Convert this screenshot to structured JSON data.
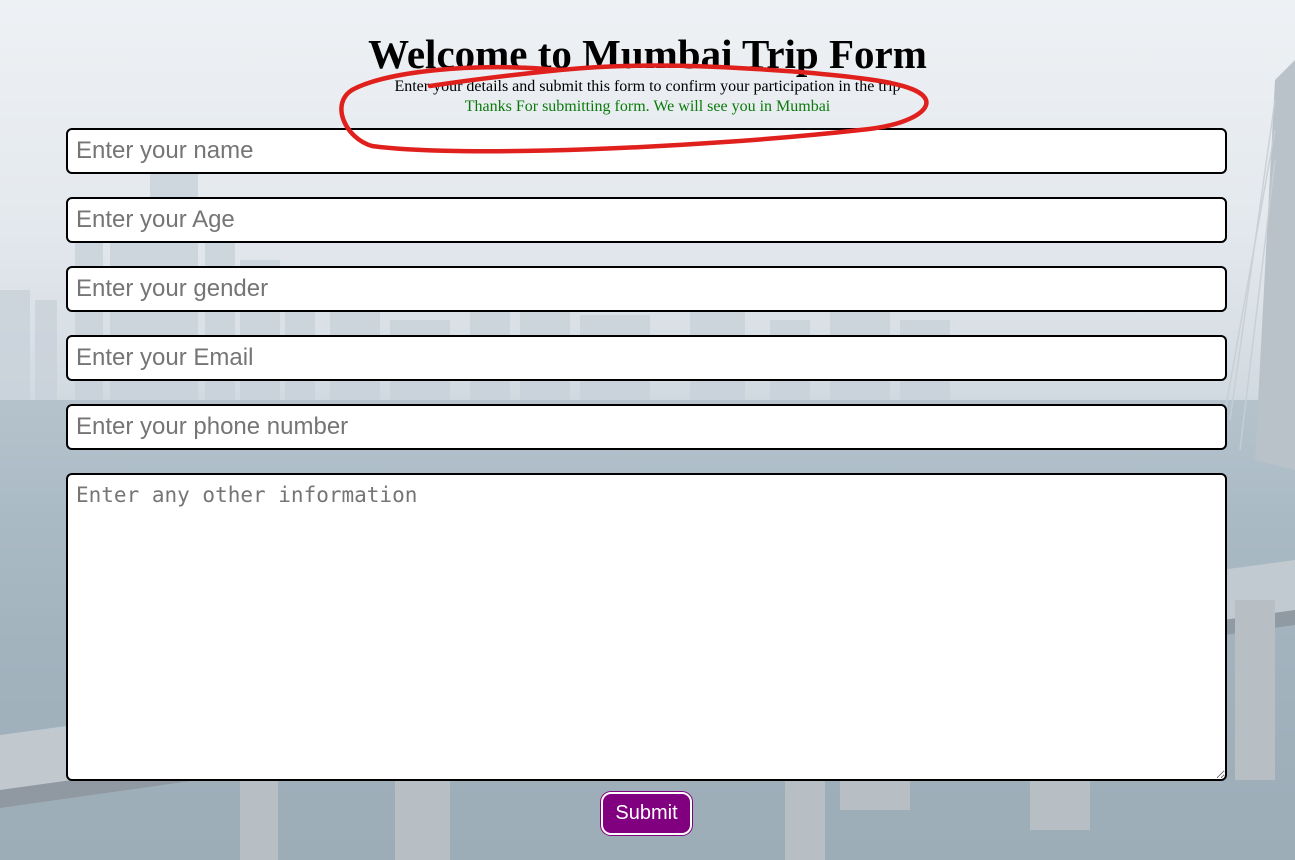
{
  "header": {
    "title": "Welcome to Mumbai Trip Form",
    "subtitle": "Enter your details and submit this form to confirm your participation in the trip",
    "success_message": "Thanks For submitting form. We will see you in Mumbai"
  },
  "form": {
    "name_placeholder": "Enter your name",
    "age_placeholder": "Enter your Age",
    "gender_placeholder": "Enter your gender",
    "email_placeholder": "Enter your Email",
    "phone_placeholder": "Enter your phone number",
    "info_placeholder": "Enter any other information",
    "submit_label": "Submit"
  },
  "colors": {
    "accent": "#800080",
    "success": "#0a7a0a",
    "annotation": "#e0201c"
  },
  "background": {
    "image_description_icon": "bridge-sea-link-background"
  }
}
